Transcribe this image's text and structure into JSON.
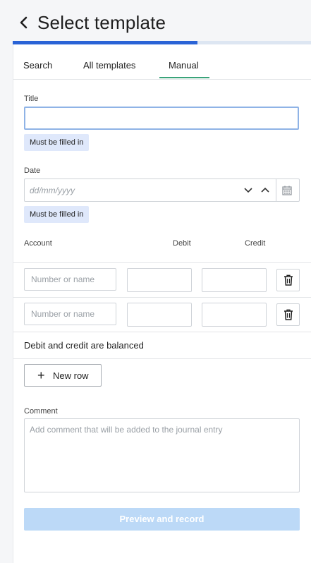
{
  "header": {
    "title": "Select template",
    "progress_fraction": 0.62
  },
  "tabs": [
    {
      "label": "Search",
      "active": false
    },
    {
      "label": "All templates",
      "active": false
    },
    {
      "label": "Manual",
      "active": true
    }
  ],
  "form": {
    "title_label": "Title",
    "title_value": "",
    "title_error": "Must be filled in",
    "date_label": "Date",
    "date_placeholder": "dd/mm/yyyy",
    "date_error": "Must be filled in",
    "columns": {
      "account": "Account",
      "debit": "Debit",
      "credit": "Credit"
    },
    "rows": [
      {
        "account_placeholder": "Number or name",
        "debit": "",
        "credit": ""
      },
      {
        "account_placeholder": "Number or name",
        "debit": "",
        "credit": ""
      }
    ],
    "balance_status": "Debit and credit are balanced",
    "new_row_label": "New row",
    "comment_label": "Comment",
    "comment_placeholder": "Add comment that will be added to the journal entry",
    "submit_label": "Preview and record"
  },
  "colors": {
    "accent": "#2a63d6",
    "tab_active": "#3aa37a",
    "badge_bg": "#dfe8fb",
    "button_disabled": "#bcd9f7"
  },
  "icons": [
    "chevron-left-icon",
    "chevron-down-icon",
    "chevron-up-icon",
    "calendar-icon",
    "trash-icon",
    "plus-icon"
  ]
}
